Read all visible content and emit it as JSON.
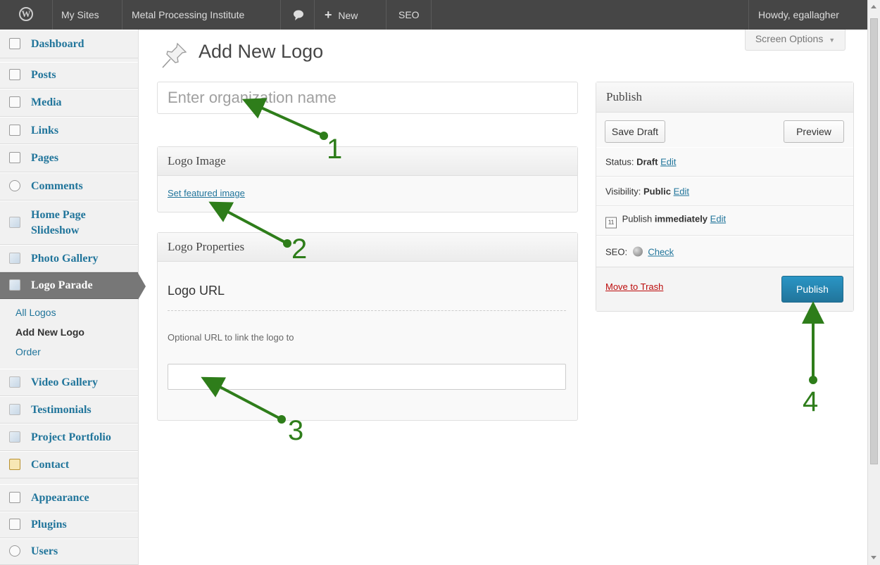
{
  "admin_bar": {
    "my_sites": "My Sites",
    "site_name": "Metal Processing Institute",
    "new_label": "New",
    "seo_label": "SEO",
    "howdy": "Howdy, egallagher"
  },
  "sidebar": {
    "items": [
      {
        "label": "Dashboard",
        "icon": "dashboard-icon"
      },
      {
        "label": "Posts",
        "icon": "pin-icon"
      },
      {
        "label": "Media",
        "icon": "media-icon"
      },
      {
        "label": "Links",
        "icon": "links-icon"
      },
      {
        "label": "Pages",
        "icon": "pages-icon"
      },
      {
        "label": "Comments",
        "icon": "comments-icon"
      },
      {
        "label": "Home Page Slideshow",
        "icon": "broken-image-icon"
      },
      {
        "label": "Photo Gallery",
        "icon": "broken-image-icon"
      },
      {
        "label": "Logo Parade",
        "icon": "broken-image-icon"
      },
      {
        "label": "Video Gallery",
        "icon": "broken-image-icon"
      },
      {
        "label": "Testimonials",
        "icon": "broken-image-icon"
      },
      {
        "label": "Project Portfolio",
        "icon": "broken-image-icon"
      },
      {
        "label": "Contact",
        "icon": "contact-icon"
      },
      {
        "label": "Appearance",
        "icon": "appearance-icon"
      },
      {
        "label": "Plugins",
        "icon": "plugins-icon"
      },
      {
        "label": "Users",
        "icon": "users-icon"
      }
    ],
    "submenu": [
      "All Logos",
      "Add New Logo",
      "Order"
    ]
  },
  "screen_options": "Screen Options",
  "page_title": "Add New Logo",
  "title_placeholder": "Enter organization name",
  "logo_image": {
    "title": "Logo Image",
    "link": "Set featured image"
  },
  "logo_properties": {
    "title": "Logo Properties",
    "field_label": "Logo URL",
    "description": "Optional URL to link the logo to",
    "url_value": ""
  },
  "publish": {
    "title": "Publish",
    "save_draft": "Save Draft",
    "preview": "Preview",
    "status_label": "Status:",
    "status_value": "Draft",
    "visibility_label": "Visibility:",
    "visibility_value": "Public",
    "publish_label": "Publish",
    "publish_value": "immediately",
    "seo_label": "SEO:",
    "seo_check": "Check",
    "edit": "Edit",
    "trash": "Move to Trash",
    "publish_button": "Publish"
  },
  "annotations": [
    "1",
    "2",
    "3",
    "4"
  ],
  "colors": {
    "admin_bar": "#464646",
    "link": "#21759b",
    "current_menu": "#777777",
    "publish_button": "#21759b",
    "trash": "#bc0b0b",
    "annotation_arrow": "#2e7d1a"
  }
}
